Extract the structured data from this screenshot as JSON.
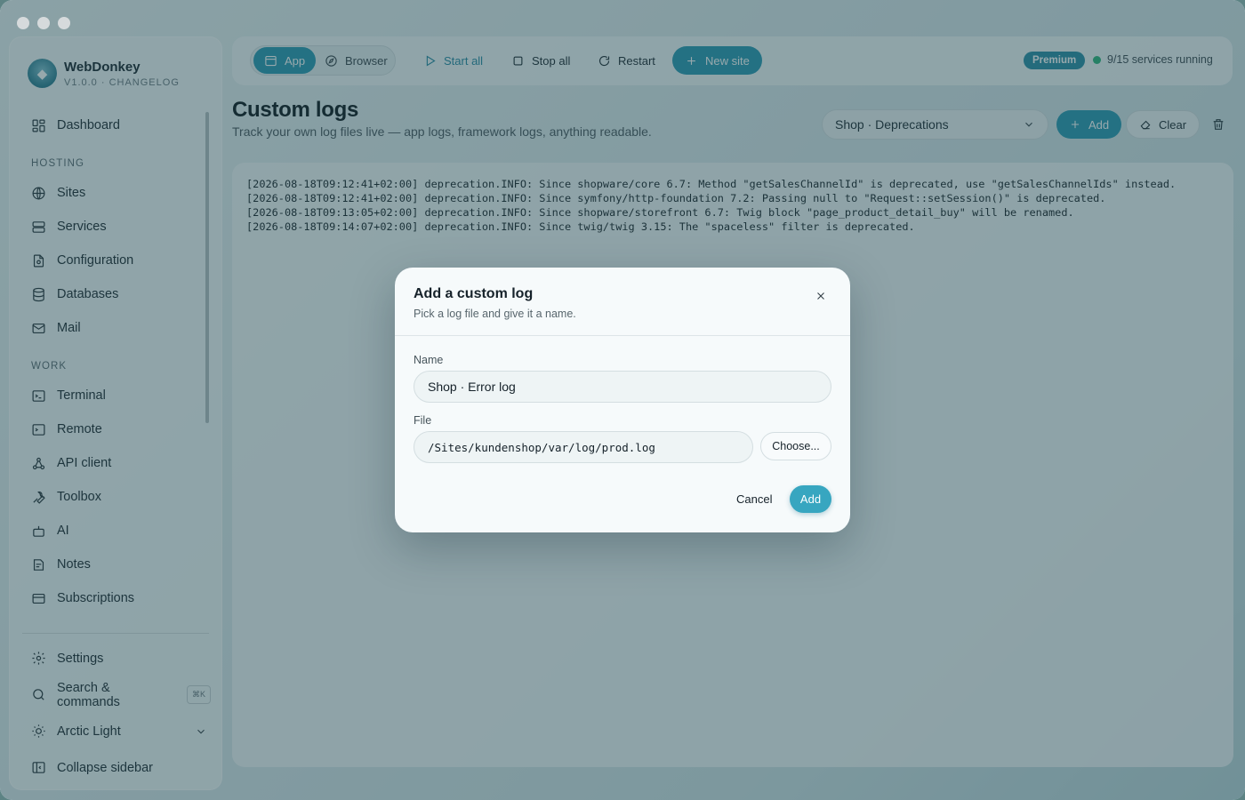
{
  "app": {
    "name": "WebDonkey",
    "version": "V1.0.0 · CHANGELOG"
  },
  "sidebar": {
    "top": [
      {
        "label": "Dashboard",
        "icon": "dashboard-icon"
      }
    ],
    "sections": [
      {
        "title": "HOSTING",
        "items": [
          {
            "label": "Sites",
            "icon": "globe-icon"
          },
          {
            "label": "Services",
            "icon": "server-icon"
          },
          {
            "label": "Configuration",
            "icon": "config-file-icon"
          },
          {
            "label": "Databases",
            "icon": "database-icon"
          },
          {
            "label": "Mail",
            "icon": "mail-icon"
          }
        ]
      },
      {
        "title": "WORK",
        "items": [
          {
            "label": "Terminal",
            "icon": "terminal-icon"
          },
          {
            "label": "Remote",
            "icon": "remote-terminal-icon"
          },
          {
            "label": "API client",
            "icon": "api-icon"
          },
          {
            "label": "Toolbox",
            "icon": "wrench-icon"
          },
          {
            "label": "AI",
            "icon": "bot-icon"
          },
          {
            "label": "Notes",
            "icon": "notes-icon"
          },
          {
            "label": "Subscriptions",
            "icon": "card-icon"
          }
        ]
      }
    ],
    "bottom": {
      "settings": "Settings",
      "search": "Search & commands",
      "search_shortcut": "⌘K",
      "theme": "Arctic Light",
      "collapse": "Collapse sidebar"
    }
  },
  "toolbar": {
    "app": "App",
    "browser": "Browser",
    "start_all": "Start all",
    "stop_all": "Stop all",
    "restart": "Restart",
    "new_site": "New site",
    "premium": "Premium",
    "status": "9/15 services running",
    "status_color": "#2fb67c"
  },
  "page": {
    "title": "Custom logs",
    "subtitle": "Track your own log files live — app logs, framework logs, anything readable.",
    "selected_log": "Shop · Deprecations",
    "add": "Add",
    "clear": "Clear"
  },
  "logs": [
    "[2026-08-18T09:12:41+02:00] deprecation.INFO: Since shopware/core 6.7: Method \"getSalesChannelId\" is deprecated, use \"getSalesChannelIds\" instead.",
    "[2026-08-18T09:12:41+02:00] deprecation.INFO: Since symfony/http-foundation 7.2: Passing null to \"Request::setSession()\" is deprecated.",
    "[2026-08-18T09:13:05+02:00] deprecation.INFO: Since shopware/storefront 6.7: Twig block \"page_product_detail_buy\" will be renamed.",
    "[2026-08-18T09:14:07+02:00] deprecation.INFO: Since twig/twig 3.15: The \"spaceless\" filter is deprecated."
  ],
  "modal": {
    "title": "Add a custom log",
    "subtitle": "Pick a log file and give it a name.",
    "name_label": "Name",
    "name_value": "Shop · Error log",
    "file_label": "File",
    "file_value": "/Sites/kundenshop/var/log/prod.log",
    "choose": "Choose...",
    "cancel": "Cancel",
    "add": "Add"
  },
  "colors": {
    "accent": "#2c9ab3",
    "overlay": "#1c424a"
  }
}
